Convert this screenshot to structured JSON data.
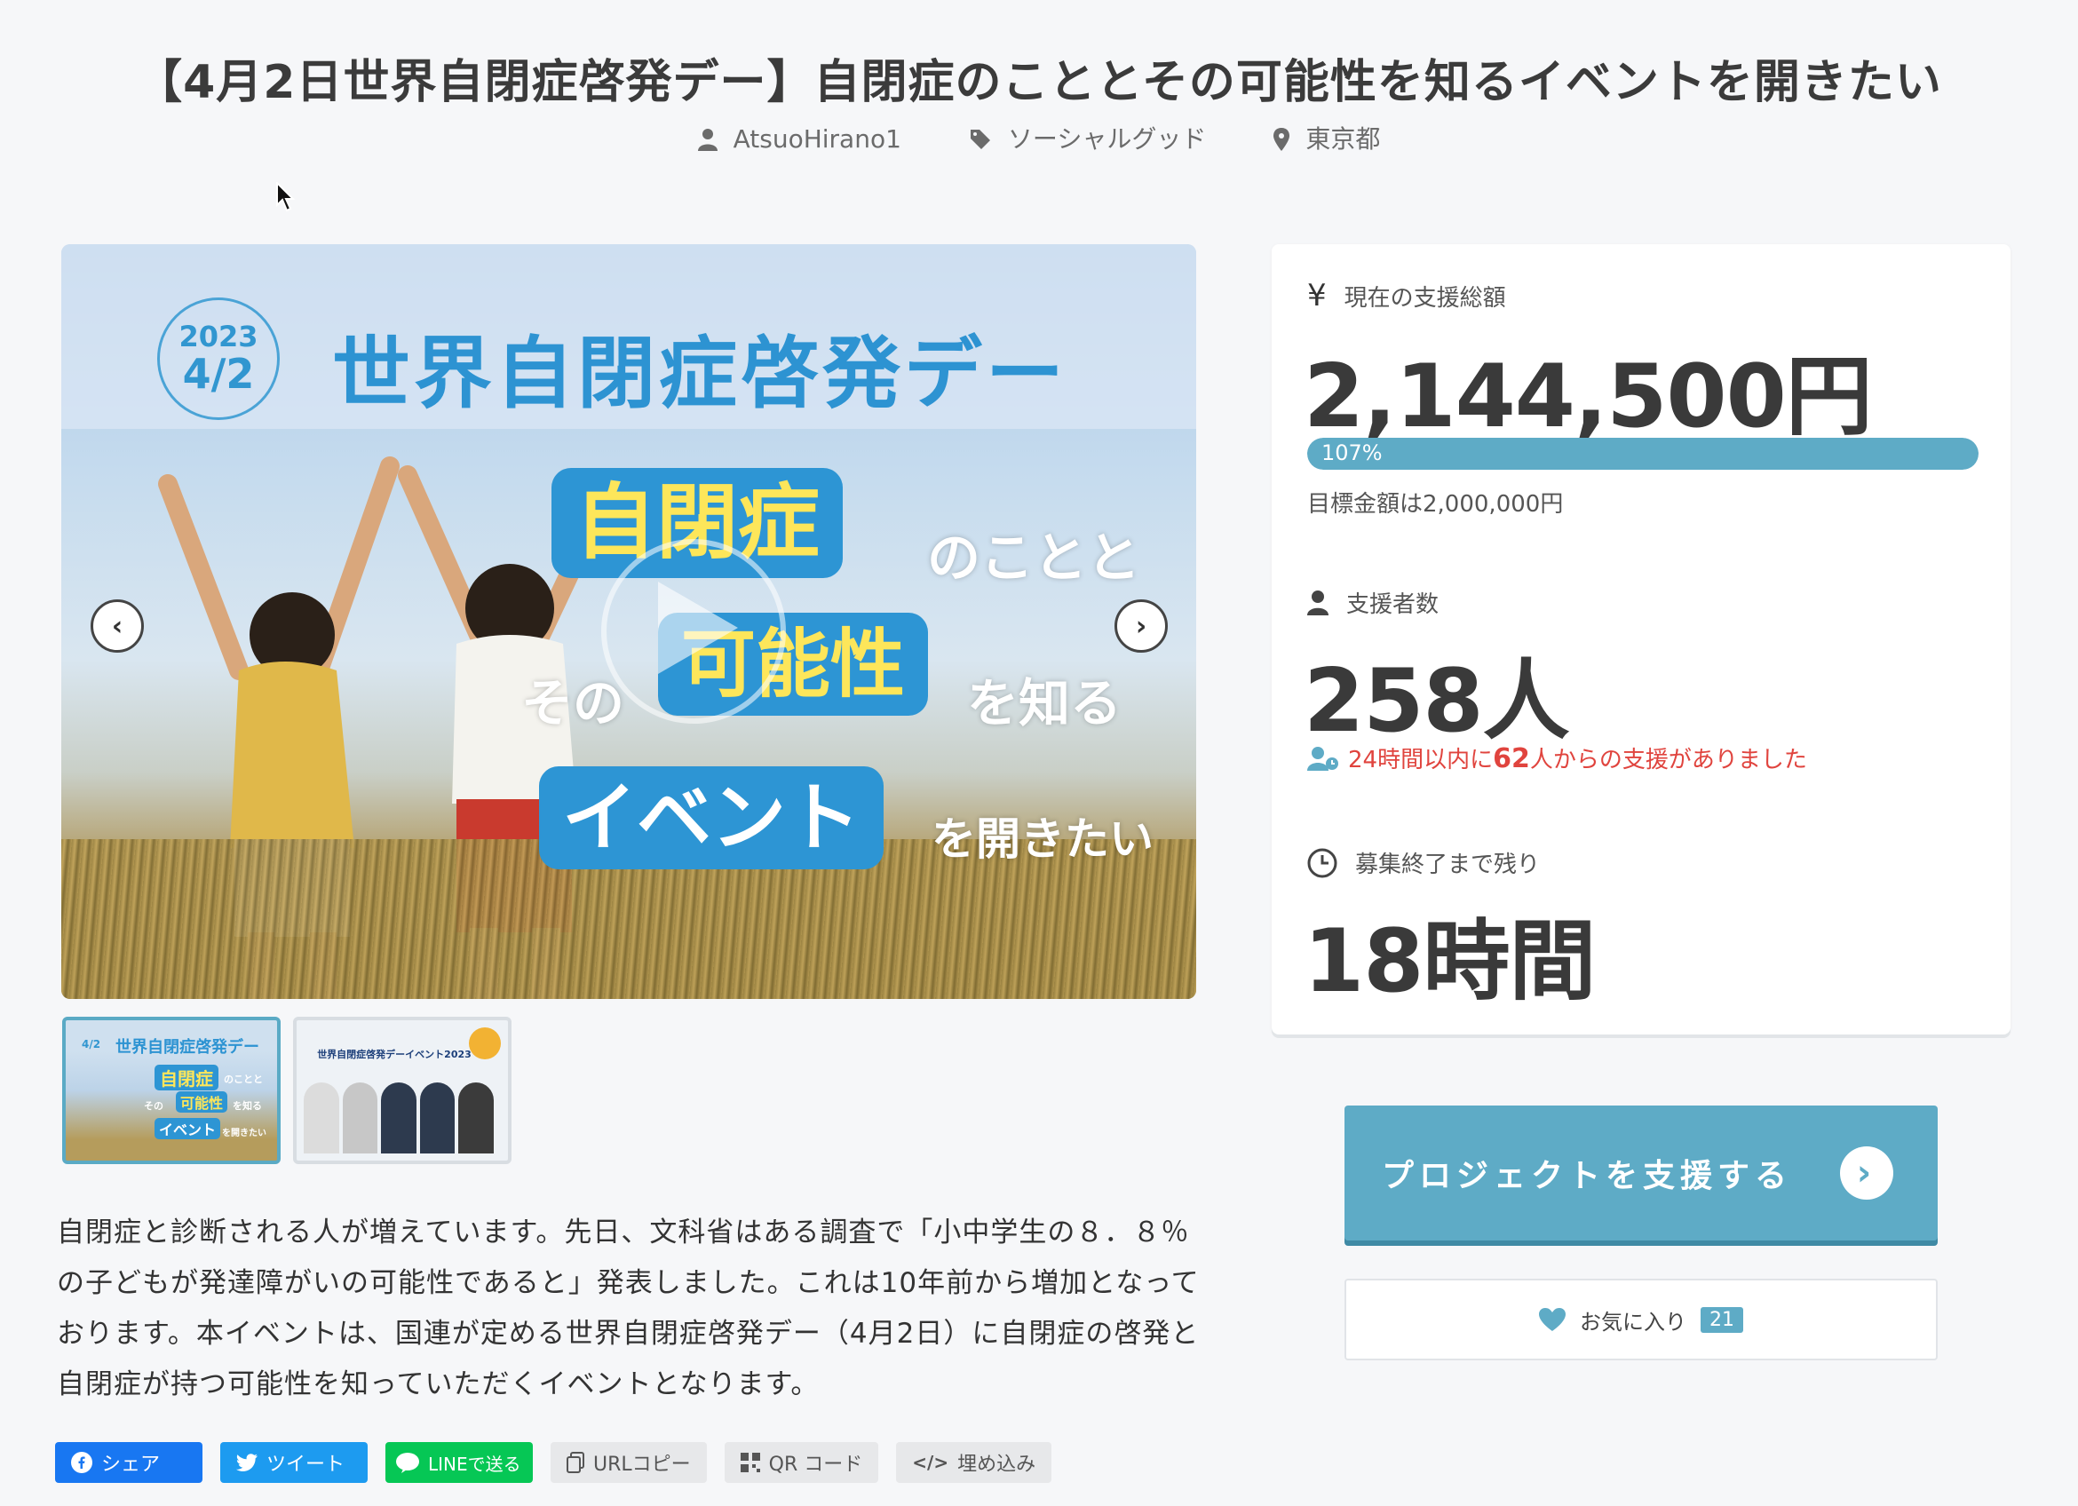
{
  "page": {
    "title": "【4月2日世界自閉症啓発デー】自閉症のこととその可能性を知るイベントを開きたい"
  },
  "meta": {
    "author": "AtsuoHirano1",
    "category": "ソーシャルグッド",
    "location": "東京都",
    "icons": [
      "user-icon",
      "tag-icon",
      "map-pin-icon"
    ]
  },
  "hero": {
    "year": "2023",
    "date": "4/2",
    "headline": "世界自閉症啓発デー",
    "pill1": "自閉症",
    "text1": "のことと",
    "text2": "その",
    "pill2": "可能性",
    "text3": "を知る",
    "pill3": "イベント",
    "text4": "を開きたい"
  },
  "thumbnails": {
    "thumb1": {
      "date": "4/2",
      "headline": "世界自閉症啓発デー",
      "pill1": "自閉症",
      "text1": "のことと",
      "text2": "その",
      "pill2": "可能性",
      "text3": "を知る",
      "pill3": "イベント",
      "text4": "を開きたい"
    },
    "thumb2": {
      "headline": "世界自閉症啓発デーイベント2023"
    }
  },
  "description": "自閉症と診断される人が増えています。先日、文科省はある調査で「小中学生の８．８％の子どもが発達障がいの可能性であると」発表しました。これは10年前から増加となっております。本イベントは、国連が定める世界自閉症啓発デー（4月2日）に自閉症の啓発と自閉症が持つ可能性を知っていただくイベントとなります。",
  "share": {
    "facebook": "シェア",
    "twitter": "ツイート",
    "line": "LINEで送る",
    "url_copy": "URLコピー",
    "qr": "QR コード",
    "embed": "埋め込み",
    "colors": {
      "facebook": "#1877f2",
      "twitter": "#1d9bf0",
      "line": "#06c755"
    }
  },
  "stats": {
    "total_label": "現在の支援総額",
    "total": "2,144,500円",
    "percent": "107%",
    "percent_value": 107,
    "goal": "目標金額は2,000,000円",
    "backers_label": "支援者数",
    "backers": "258人",
    "recent_prefix": "24時間以内に",
    "recent_count": "62",
    "recent_suffix": "人からの支援がありました",
    "remaining_label": "募集終了まで残り",
    "remaining": "18時間"
  },
  "actions": {
    "support": "プロジェクトを支援する",
    "favorite": "お気に入り",
    "favorite_count": "21"
  },
  "colors": {
    "accent": "#5eabc6",
    "hero_blue": "#2d95d4",
    "hero_yellow": "#fde65a",
    "alert": "#e0443e"
  }
}
